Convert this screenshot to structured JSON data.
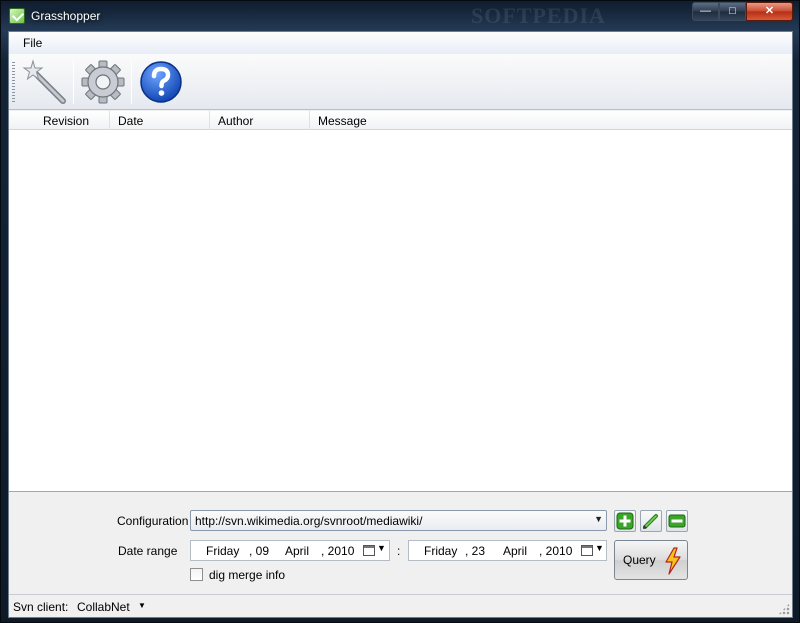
{
  "window": {
    "title": "Grasshopper",
    "watermark": "SOFTPEDIA",
    "buttons": [
      "—",
      "□",
      "✕"
    ]
  },
  "menu": {
    "file": "File"
  },
  "toolbar": {
    "items": [
      "wizard-icon",
      "settings-gear-icon",
      "help-icon"
    ]
  },
  "list": {
    "columns": [
      "Revision",
      "Date",
      "Author",
      "Message"
    ]
  },
  "form": {
    "configuration_label": "Configuration",
    "configuration_value": "http://svn.wikimedia.org/svnroot/mediawiki/",
    "date_range_label": "Date range",
    "from": {
      "weekday": "Friday",
      "day": ", 09",
      "month": "April",
      "year": ", 2010"
    },
    "separator": ":",
    "to": {
      "weekday": "Friday",
      "day": ", 23",
      "month": "April",
      "year": ", 2010"
    },
    "dig_merge_label": "dig merge info",
    "dig_merge_checked": false,
    "query_label": "Query",
    "config_buttons": [
      "add-icon",
      "edit-icon",
      "remove-icon"
    ]
  },
  "status": {
    "svn_client_label": "Svn client:",
    "svn_client_value": "CollabNet"
  },
  "colors": {
    "accent_green": "#3aa52a",
    "help_blue": "#1d5fd1",
    "bolt_yellow": "#f4c21a"
  }
}
